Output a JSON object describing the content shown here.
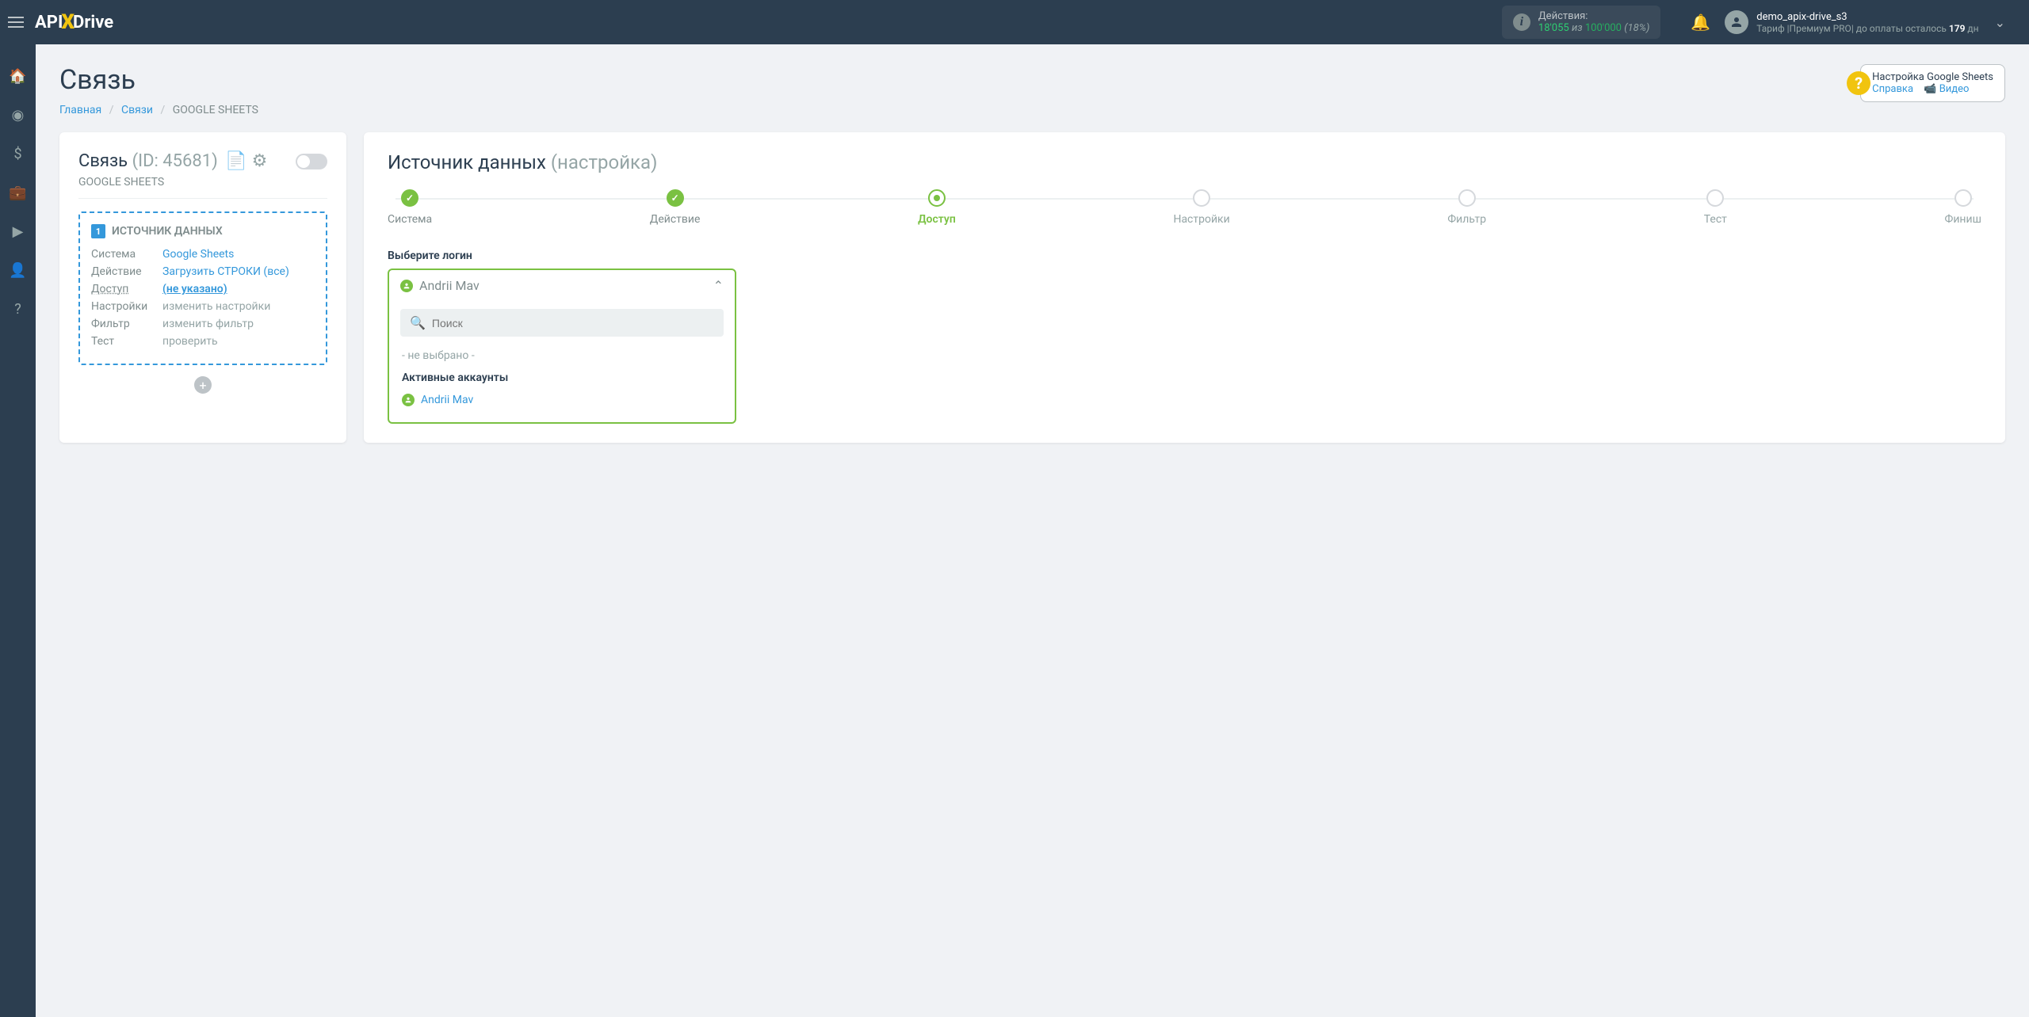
{
  "header": {
    "logo_pre": "API",
    "logo_x": "X",
    "logo_post": "Drive",
    "actions_label": "Действия:",
    "actions_used": "18'055",
    "actions_of": "из",
    "actions_limit": "100'000",
    "actions_pct": "(18%)",
    "user_name": "demo_apix-drive_s3",
    "tariff_pre": "Тариф |Премиум PRO| до оплаты осталось ",
    "tariff_days": "179",
    "tariff_post": " дн"
  },
  "page": {
    "title": "Связь",
    "crumb_home": "Главная",
    "crumb_links": "Связи",
    "crumb_current": "GOOGLE SHEETS"
  },
  "help": {
    "title": "Настройка Google Sheets",
    "ref": "Справка",
    "video": "Видео"
  },
  "left": {
    "conn": "Связь",
    "conn_id": "(ID: 45681)",
    "sub": "GOOGLE SHEETS",
    "box_title": "ИСТОЧНИК ДАННЫХ",
    "rows": {
      "system_l": "Система",
      "system_v": "Google Sheets",
      "action_l": "Действие",
      "action_v": "Загрузить СТРОКИ (все)",
      "access_l": "Доступ",
      "access_v": "(не указано)",
      "settings_l": "Настройки",
      "settings_v": "изменить настройки",
      "filter_l": "Фильтр",
      "filter_v": "изменить фильтр",
      "test_l": "Тест",
      "test_v": "проверить"
    }
  },
  "right": {
    "title_main": "Источник данных",
    "title_sub": "(настройка)",
    "steps": [
      "Система",
      "Действие",
      "Доступ",
      "Настройки",
      "Фильтр",
      "Тест",
      "Финиш"
    ],
    "field_label": "Выберите логин",
    "selected": "Andrii Mav",
    "search_ph": "Поиск",
    "opt_none": "- не выбрано -",
    "opt_hdr": "Активные аккаунты",
    "opt_acct": "Andrii Mav"
  }
}
